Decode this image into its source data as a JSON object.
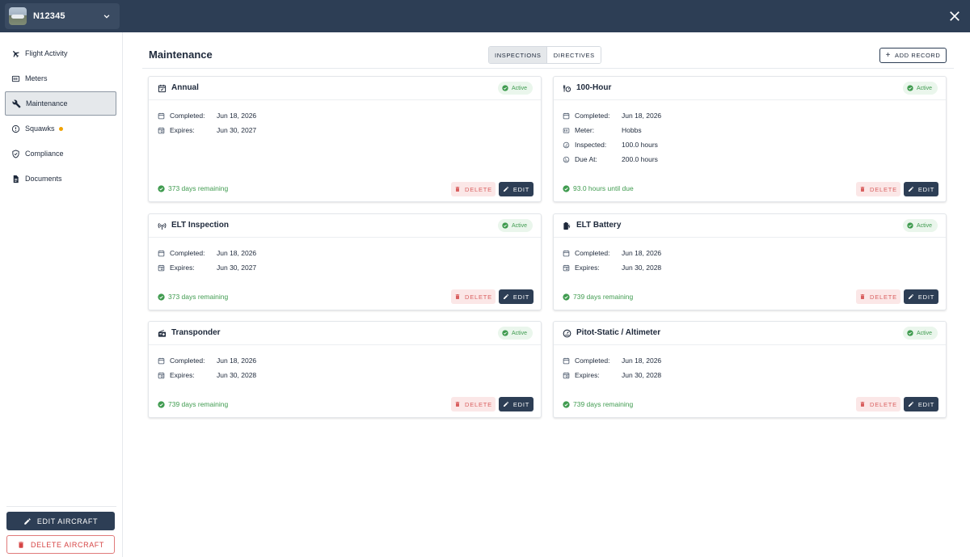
{
  "header": {
    "aircraft": "N12345",
    "aircraft_avatar": "aircraft-photo",
    "close_icon": "close-icon"
  },
  "sidebar": {
    "items": [
      {
        "label": "Flight Activity",
        "icon": "airplane-icon"
      },
      {
        "label": "Meters",
        "icon": "meter-icon"
      },
      {
        "label": "Maintenance",
        "icon": "wrench-icon",
        "active": true
      },
      {
        "label": "Squawks",
        "icon": "alert-circle-icon",
        "dot_color": "#f0a202"
      },
      {
        "label": "Compliance",
        "icon": "shield-check-icon"
      },
      {
        "label": "Documents",
        "icon": "document-icon"
      }
    ],
    "edit_aircraft": "EDIT AIRCRAFT",
    "delete_aircraft": "DELETE AIRCRAFT"
  },
  "main": {
    "title": "Maintenance",
    "tabs": [
      {
        "label": "INSPECTIONS",
        "active": true
      },
      {
        "label": "DIRECTIVES",
        "active": false
      }
    ],
    "add_record": "ADD RECORD"
  },
  "labels": {
    "completed": "Completed:",
    "expires": "Expires:",
    "meter": "Meter:",
    "inspected": "Inspected:",
    "due_at": "Due At:",
    "status": "Active",
    "delete": "DELETE",
    "edit": "EDIT"
  },
  "cards": [
    {
      "title": "Annual",
      "icon": "calendar-check-icon",
      "completed": "Jun 18, 2026",
      "expires": "Jun 30, 2027",
      "remaining": "373 days remaining"
    },
    {
      "title": "100-Hour",
      "icon": "meter-gauge-icon",
      "completed": "Jun 18, 2026",
      "meter": "Hobbs",
      "inspected": "100.0 hours",
      "due_at": "200.0 hours",
      "remaining": "93.0 hours until due"
    },
    {
      "title": "ELT Inspection",
      "icon": "radio-signal-icon",
      "completed": "Jun 18, 2026",
      "expires": "Jun 30, 2027",
      "remaining": "373 days remaining"
    },
    {
      "title": "ELT Battery",
      "icon": "battery-icon",
      "completed": "Jun 18, 2026",
      "expires": "Jun 30, 2028",
      "remaining": "739 days remaining"
    },
    {
      "title": "Transponder",
      "icon": "transponder-icon",
      "completed": "Jun 18, 2026",
      "expires": "Jun 30, 2028",
      "remaining": "739 days remaining"
    },
    {
      "title": "Pitot-Static / Altimeter",
      "icon": "gauge-icon",
      "completed": "Jun 18, 2026",
      "expires": "Jun 30, 2028",
      "remaining": "739 days remaining"
    }
  ],
  "colors": {
    "header_bg": "#2d3e55",
    "accent": "#2d3e55",
    "success": "#3f9b4f",
    "danger": "#d64545",
    "warning_dot": "#f0a202"
  }
}
